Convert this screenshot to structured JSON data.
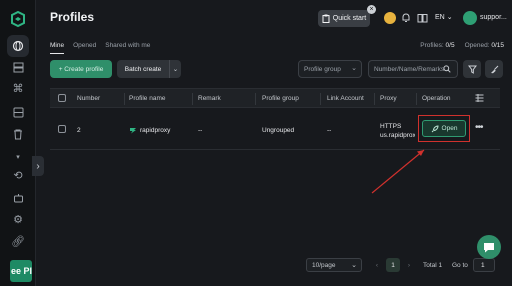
{
  "header": {
    "title": "Profiles"
  },
  "topbar": {
    "quick_start_label": "Quick start",
    "lang": "EN",
    "user": "suppor..."
  },
  "tabs": [
    {
      "label": "Mine"
    },
    {
      "label": "Opened"
    },
    {
      "label": "Shared with me"
    }
  ],
  "stats": {
    "profiles_label": "Profiles:",
    "profiles_value": "0/5",
    "opened_label": "Opened:",
    "opened_value": "0/15"
  },
  "toolbar": {
    "create_label": "+ Create profile",
    "batch_label": "Batch create",
    "group_placeholder": "Profile group",
    "search_placeholder": "Number/Name/Remarks"
  },
  "table": {
    "headers": {
      "number": "Number",
      "name": "Profile name",
      "remark": "Remark",
      "group": "Profile group",
      "link": "Link Account",
      "proxy": "Proxy",
      "operation": "Operation"
    },
    "rows": [
      {
        "number": "2",
        "name": "rapidproxy",
        "remark": "--",
        "group": "Ungrouped",
        "link": "--",
        "proxy_type": "HTTPS",
        "proxy_host": "us.rapidproxy",
        "action": "Open"
      }
    ]
  },
  "pagination": {
    "page_size": "10/page",
    "current": "1",
    "total": "Total 1",
    "goto_label": "Go to",
    "goto_value": "1"
  },
  "sidebar": {
    "promo_text": "ee Pl"
  },
  "colors": {
    "accent": "#2f8f6a",
    "highlight": "#d0312d",
    "background": "#17191d"
  }
}
